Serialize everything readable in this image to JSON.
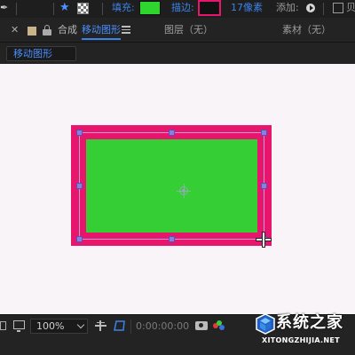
{
  "toolbar": {
    "fill_label": "填充:",
    "fill_color": "#2fd52f",
    "stroke_label": "描边:",
    "stroke_color": "#e8156c",
    "stroke_width_value": "17",
    "stroke_width_unit": "像素",
    "add_label": "添加:",
    "trailing_label": "贝",
    "icons": [
      "pen-tool-icon",
      "star-icon",
      "checker-icon",
      "add-play-icon"
    ]
  },
  "panel_header": {
    "composition_label": "合成",
    "composition_name": "移动图形",
    "layer_panel": "图层（无）",
    "footage_panel": "素材（无）"
  },
  "breadcrumb": {
    "label": "移动图形"
  },
  "canvas": {
    "background_color": "#f8f4f7",
    "shape_fill_color": "#35ce35",
    "shape_stroke_color": "#e8156c"
  },
  "bottom_bar": {
    "zoom": "100%",
    "timecode": "0:00:00:00"
  },
  "watermark": {
    "brand": "系统之家",
    "domain": "XITONGZHIJIA.NET"
  },
  "colors": {
    "accent_blue": "#3c82e8",
    "panel_bg": "#232323"
  }
}
